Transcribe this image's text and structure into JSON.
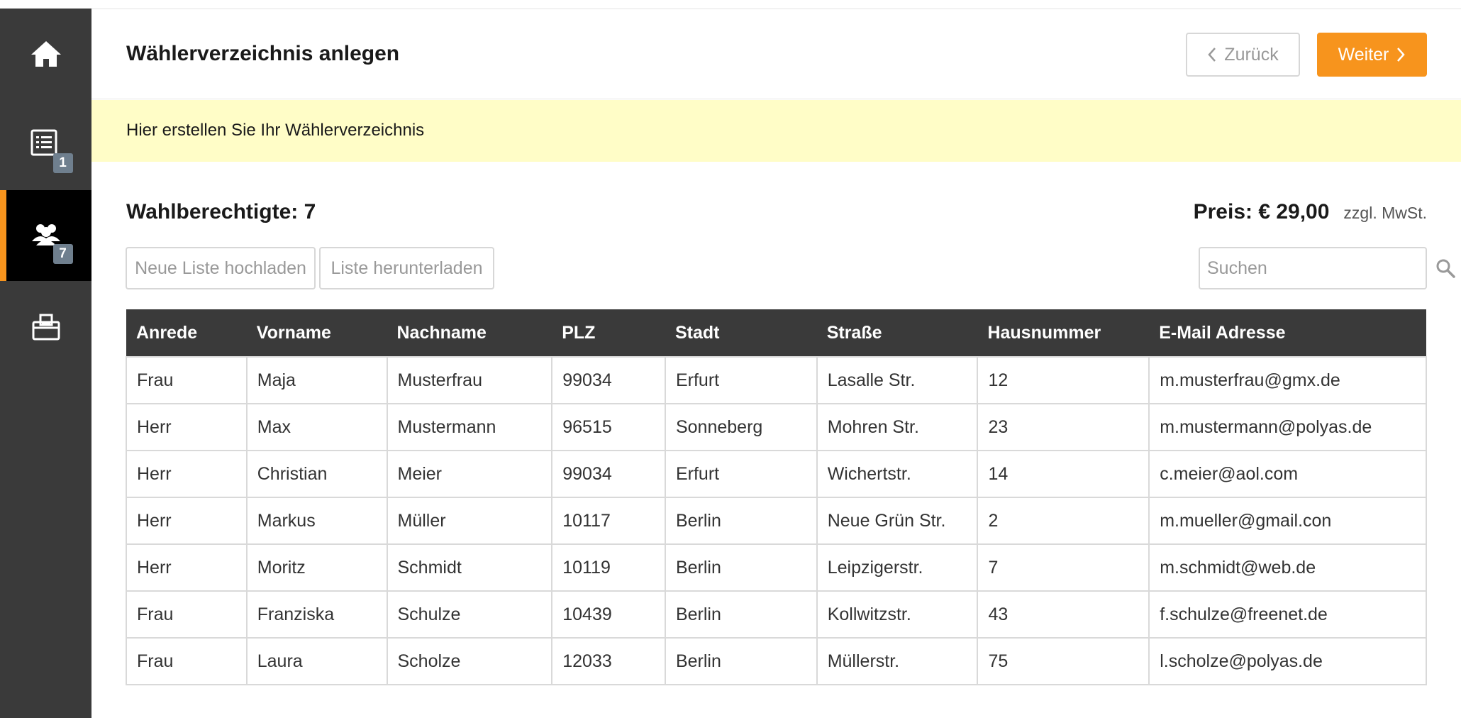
{
  "sidebar": {
    "items": [
      {
        "icon": "home-icon",
        "badge": ""
      },
      {
        "icon": "list-icon",
        "badge": "1"
      },
      {
        "icon": "users-icon",
        "badge": "7"
      },
      {
        "icon": "ballot-box-icon",
        "badge": ""
      }
    ]
  },
  "header": {
    "title": "Wählerverzeichnis anlegen",
    "back_label": "Zurück",
    "next_label": "Weiter"
  },
  "info": {
    "text": "Hier erstellen Sie Ihr Wählerverzeichnis"
  },
  "summary": {
    "count_label": "Wahlberechtigte: 7",
    "price_label": "Preis: € 29,00",
    "price_note": "zzgl. MwSt."
  },
  "actions": {
    "upload_label": "Neue Liste hochladen",
    "download_label": "Liste herunterladen",
    "search_placeholder": "Suchen"
  },
  "table": {
    "columns": [
      "Anrede",
      "Vorname",
      "Nachname",
      "PLZ",
      "Stadt",
      "Straße",
      "Hausnummer",
      "E-Mail Adresse"
    ],
    "rows": [
      [
        "Frau",
        "Maja",
        "Musterfrau",
        "99034",
        "Erfurt",
        "Lasalle Str.",
        "12",
        "m.musterfrau@gmx.de"
      ],
      [
        "Herr",
        "Max",
        "Mustermann",
        "96515",
        "Sonneberg",
        "Mohren Str.",
        "23",
        "m.mustermann@polyas.de"
      ],
      [
        "Herr",
        "Christian",
        "Meier",
        "99034",
        "Erfurt",
        "Wichertstr.",
        "14",
        "c.meier@aol.com"
      ],
      [
        "Herr",
        "Markus",
        "Müller",
        "10117",
        "Berlin",
        "Neue Grün Str.",
        "2",
        "m.mueller@gmail.con"
      ],
      [
        "Herr",
        "Moritz",
        "Schmidt",
        "10119",
        "Berlin",
        "Leipzigerstr.",
        "7",
        "m.schmidt@web.de"
      ],
      [
        "Frau",
        "Franziska",
        "Schulze",
        "10439",
        "Berlin",
        "Kollwitzstr.",
        "43",
        "f.schulze@freenet.de"
      ],
      [
        "Frau",
        "Laura",
        "Scholze",
        "12033",
        "Berlin",
        "Müllerstr.",
        "75",
        "l.scholze@polyas.de"
      ]
    ]
  },
  "colors": {
    "accent": "#f7941d",
    "sidebar": "#3a3a3a",
    "info_bar": "#fffdc7",
    "badge": "#6f7f8e"
  }
}
